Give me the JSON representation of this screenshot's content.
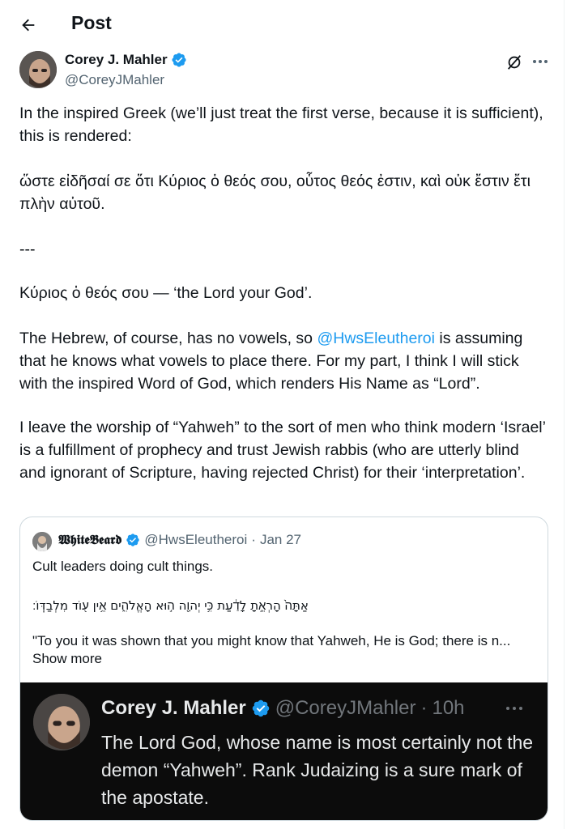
{
  "header": {
    "title": "Post"
  },
  "author": {
    "name": "Corey J. Mahler",
    "handle": "@CoreyJMahler"
  },
  "post": {
    "p1": "In the inspired Greek (we’ll just treat the first verse, because it is sufficient), this is rendered:",
    "p2": "ὥστε εἰδῆσαί σε ὅτι Κύριος ὁ θεός σου, οὗτος θεός ἐστιν, καὶ οὐκ ἔστιν ἔτι πλὴν αὐτοῦ.",
    "p3": "---",
    "p4": "Κύριος ὁ θεός σου — ‘the Lord your God’.",
    "p5_before": "The Hebrew, of course, has no vowels, so ",
    "p5_mention": "@HwsEleutheroi",
    "p5_after": " is assuming that he knows what vowels to place there. For my part, I think I will stick with the inspired Word of God, which renders His Name as “Lord”.",
    "p6": "I leave the worship of “Yahweh” to the sort of men who think modern ‘Israel’ is a fulfillment of prophecy and trust Jewish rabbis (who are utterly blind and ignorant of Scripture, having rejected Christ) for their ‘interpretation’."
  },
  "quote": {
    "name": "𝖂𝖍𝖎𝖙𝖊𝕭𝖊𝖆𝖗𝖉",
    "handle": "@HwsEleutheroi",
    "separator": "·",
    "date": "Jan 27",
    "line1": "Cult leaders doing cult things.",
    "hebrew": "אַתָּה֙ הָרְאֵ֣תָ לָדַ֔עַת כִּ֥י יְהוָ֖ה ה֣וּא הָאֱלֹהִ֑ים אֵ֥ין ע֖וֹד מִלְבַדּֽוֹ׃",
    "line3": "\"To you it was shown that you might know that Yahweh, He is God; there is n...",
    "show_more": "Show more",
    "embed": {
      "name": "Corey J. Mahler",
      "handle": "@CoreyJMahler",
      "separator": "·",
      "time": "10h",
      "text": "The Lord God, whose name is most certainly not the demon “Yahweh”. Rank Judaizing is a sure mark of the apostate."
    }
  },
  "colors": {
    "accent": "#1d9bf0",
    "text": "#0f1419",
    "muted": "#536471",
    "embed_bg": "#0c0c0c"
  }
}
